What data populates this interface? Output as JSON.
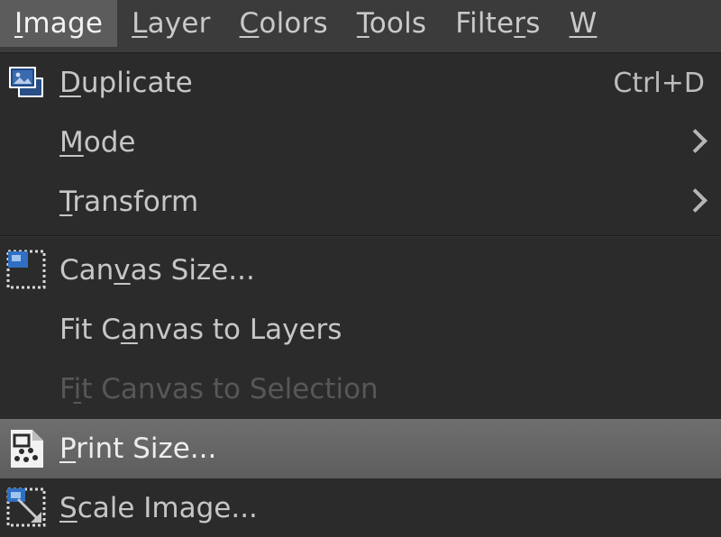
{
  "menubar": {
    "items": [
      {
        "label": "Image",
        "mnemonic": "I",
        "active": true
      },
      {
        "label": "Layer",
        "mnemonic": "L",
        "active": false
      },
      {
        "label": "Colors",
        "mnemonic": "C",
        "active": false
      },
      {
        "label": "Tools",
        "mnemonic": "T",
        "active": false
      },
      {
        "label": "Filters",
        "mnemonic": "r",
        "active": false
      },
      {
        "label": "W",
        "mnemonic": "W",
        "active": false
      }
    ]
  },
  "menu": {
    "title": "Image",
    "rows": [
      {
        "label": "Duplicate",
        "mnemonic": "D",
        "accel": "Ctrl+D",
        "icon": "duplicate-image-icon",
        "submenu": false,
        "disabled": false,
        "highlight": false
      },
      {
        "label": "Mode",
        "mnemonic": "M",
        "accel": "",
        "icon": "",
        "submenu": true,
        "disabled": false,
        "highlight": false
      },
      {
        "label": "Transform",
        "mnemonic": "T",
        "accel": "",
        "icon": "",
        "submenu": true,
        "disabled": false,
        "highlight": false
      },
      {
        "label": "Canvas Size...",
        "mnemonic": "v",
        "accel": "",
        "icon": "canvas-size-icon",
        "submenu": false,
        "disabled": false,
        "highlight": false
      },
      {
        "label": "Fit Canvas to Layers",
        "mnemonic": "a",
        "accel": "",
        "icon": "",
        "submenu": false,
        "disabled": false,
        "highlight": false
      },
      {
        "label": "Fit Canvas to Selection",
        "mnemonic": "i",
        "accel": "",
        "icon": "",
        "submenu": false,
        "disabled": true,
        "highlight": false
      },
      {
        "label": "Print Size...",
        "mnemonic": "P",
        "accel": "",
        "icon": "print-size-icon",
        "submenu": false,
        "disabled": false,
        "highlight": true
      },
      {
        "label": "Scale Image...",
        "mnemonic": "S",
        "accel": "",
        "icon": "scale-image-icon",
        "submenu": false,
        "disabled": false,
        "highlight": false
      }
    ],
    "separator_after_index": 2
  },
  "colors": {
    "menubar_bg": "#3b3b3b",
    "menubar_active_bg": "#5c5c5c",
    "panel_bg": "#2b2b2b",
    "text": "#c6c6c6",
    "text_disabled": "#575757",
    "highlight_bg": "#676767",
    "icon_blue": "#2f6fc4"
  }
}
